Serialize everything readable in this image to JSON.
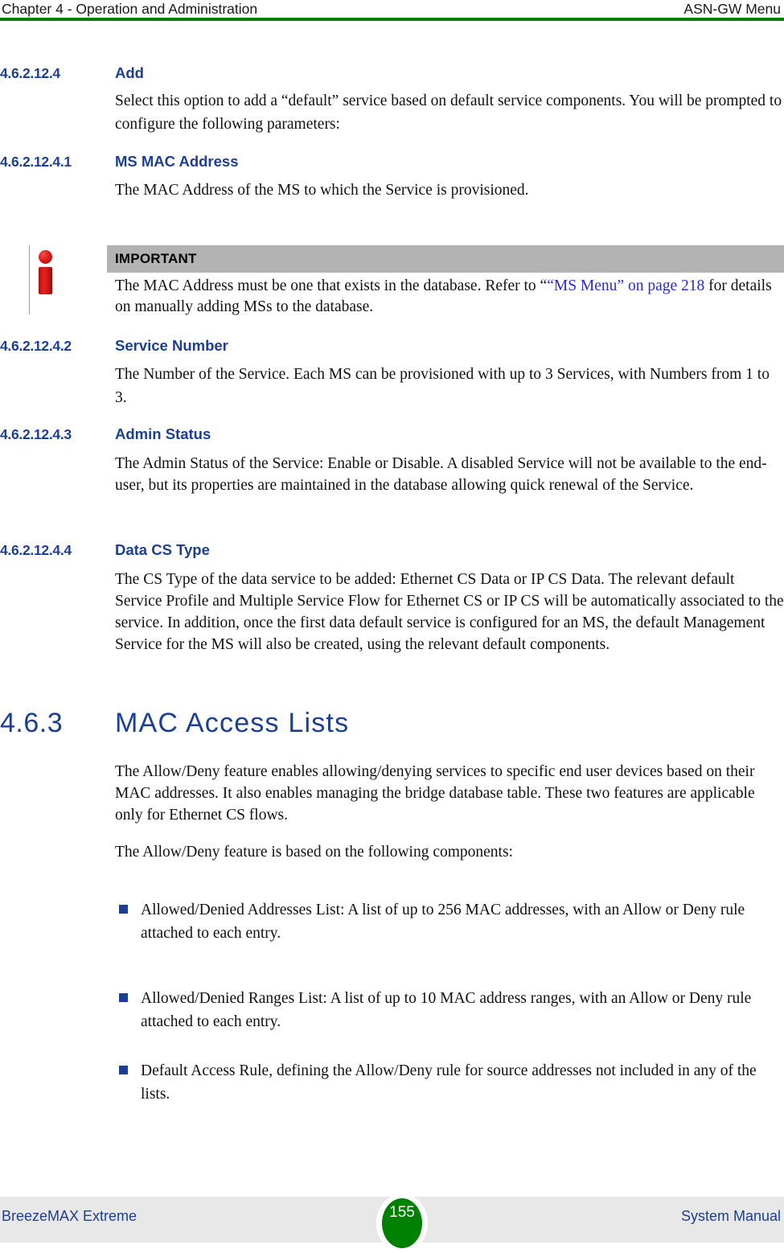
{
  "header": {
    "left": "Chapter 4 - Operation and Administration",
    "right": "ASN-GW Menu",
    "rule_color": "#008000"
  },
  "colors": {
    "heading_blue": "#1c3f94",
    "link_blue": "#2a2ad8",
    "note_bar_gray": "#b3b3b3",
    "footer_band_gray": "#e8e8e8",
    "accent_green": "#008000",
    "icon_red": "#e01c1c"
  },
  "sections": [
    {
      "number": "4.6.2.12.4",
      "title": "Add",
      "body": "Select this option to add a “default” service based on default service components. You will be prompted to configure the following parameters:"
    },
    {
      "number": "4.6.2.12.4.1",
      "title": "MS MAC Address",
      "body": "The MAC Address of the MS to which the Service is provisioned."
    },
    {
      "number": "4.6.2.12.4.2",
      "title": "Service Number",
      "body": "The Number of the Service. Each MS can be provisioned with up to 3 Services, with Numbers from 1 to 3."
    },
    {
      "number": "4.6.2.12.4.3",
      "title": "Admin Status",
      "body": "The Admin Status of the Service: Enable or Disable. A disabled Service will not be available to the end-user, but its properties are maintained in the database allowing quick renewal of the Service."
    },
    {
      "number": "4.6.2.12.4.4",
      "title": "Data CS Type",
      "body": "The CS Type of the data service to be added: Ethernet CS Data or IP CS Data. The relevant default Service Profile and Multiple Service Flow for Ethernet CS or IP CS will be automatically associated to the service. In addition, once the first data default service is configured for an MS, the default Management Service for the MS will also be created, using the relevant default components."
    }
  ],
  "note": {
    "icon": "info-i-icon",
    "title": "IMPORTANT",
    "text_before_link": "The MAC Address must be one that exists in the database. Refer to “",
    "link_text": "“MS Menu” on page 218",
    "text_after_link": " for details on manually adding MSs to the database."
  },
  "big_section": {
    "number": "4.6.3",
    "title": "MAC Access Lists",
    "paragraph_1": "The Allow/Deny feature enables allowing/denying services to specific end user devices based on their MAC addresses. It also enables managing the bridge database table. These two features are applicable only for Ethernet CS flows.",
    "paragraph_2": "The Allow/Deny feature is based on the following components:",
    "bullets": [
      "Allowed/Denied Addresses List: A list of up to 256 MAC addresses, with an Allow or Deny rule attached to each entry.",
      "Allowed/Denied Ranges List: A list of up to 10 MAC address ranges, with an Allow or Deny rule attached to each entry.",
      "Default Access Rule, defining the Allow/Deny rule for source addresses not included in any of the lists."
    ]
  },
  "footer": {
    "left": "BreezeMAX Extreme",
    "page_number": "155",
    "right": "System Manual"
  }
}
